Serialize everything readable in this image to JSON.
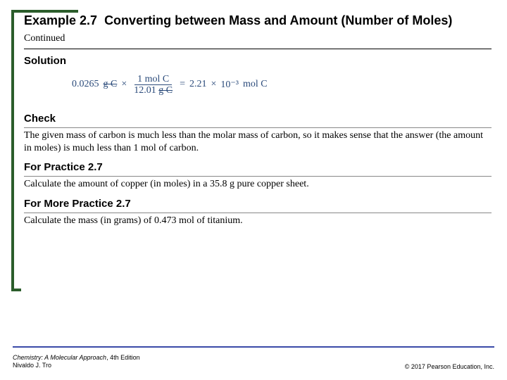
{
  "title": {
    "example_no": "Example 2.7",
    "text": "Converting between Mass and Amount (Number of Moles)",
    "continued": "Continued"
  },
  "sections": {
    "solution": "Solution",
    "check": "Check",
    "for_practice": "For Practice 2.7",
    "for_more": "For More Practice 2.7"
  },
  "equation": {
    "lhs_value": "0.0265",
    "lhs_unit": "g C",
    "times": "×",
    "frac_num_value": "1",
    "frac_num_unit": "mol C",
    "frac_den_value": "12.01",
    "frac_den_unit": "g C",
    "equals": "=",
    "rhs_mantissa": "2.21",
    "rhs_times": "×",
    "rhs_exp": "10⁻³",
    "rhs_unit": "mol C"
  },
  "check_text": "The given mass of carbon is much less than the molar mass of carbon, so it makes sense that the answer (the amount in moles) is much less than 1 mol of carbon.",
  "practice_text": "Calculate the amount of copper (in moles) in a 35.8 g pure copper sheet.",
  "more_practice_text": "Calculate the mass (in grams) of 0.473 mol of titanium.",
  "footer": {
    "book_title": "Chemistry: A Molecular Approach",
    "edition": ", 4th Edition",
    "author": "Nivaldo J. Tro",
    "copyright": "© 2017 Pearson Education, Inc."
  }
}
